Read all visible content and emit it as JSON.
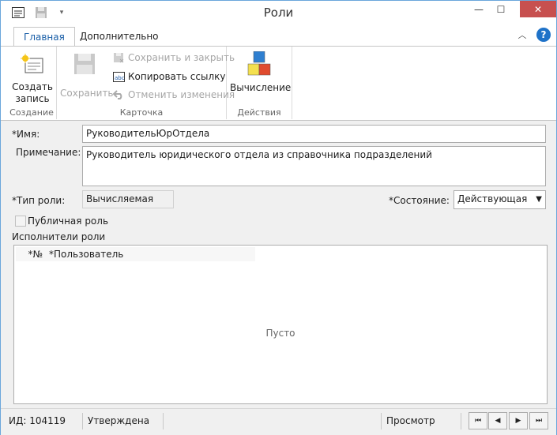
{
  "window": {
    "title": "Роли",
    "minimize_glyph": "—",
    "maximize_glyph": "☐",
    "close_glyph": "✕"
  },
  "tabs": [
    {
      "label": "Главная",
      "active": true
    },
    {
      "label": "Дополнительно",
      "active": false
    }
  ],
  "ribbon": {
    "groups": {
      "create": {
        "label": "Создание",
        "create_button": {
          "line1": "Создать",
          "line2": "запись"
        }
      },
      "card": {
        "label": "Карточка",
        "save_label": "Сохранить",
        "save_and_close_label": "Сохранить и закрыть",
        "copy_link_label": "Копировать ссылку",
        "undo_changes_label": "Отменить изменения"
      },
      "actions": {
        "label": "Действия",
        "compute_label": "Вычисление"
      }
    }
  },
  "form": {
    "name_label": "*Имя:",
    "name_value": "РуководительЮрОтдела",
    "note_label": "Примечание:",
    "note_value": "Руководитель юридического отдела из справочника подразделений",
    "role_type_label": "*Тип роли:",
    "role_type_value": "Вычисляемая",
    "state_label": "*Состояние:",
    "state_value": "Действующая",
    "public_role_label": "Публичная роль",
    "public_role_checked": false
  },
  "performers": {
    "title": "Исполнители роли",
    "columns": [
      "*№",
      "*Пользователь"
    ],
    "rows": [],
    "empty_text": "Пусто"
  },
  "statusbar": {
    "id_text": "ИД: 104119",
    "status_text": "Утверждена",
    "mode_text": "Просмотр"
  },
  "colors": {
    "accent": "#1a5fa8",
    "close_button": "#c7504f",
    "window_border": "#6aa6db",
    "help_icon": "#1e72c8"
  }
}
